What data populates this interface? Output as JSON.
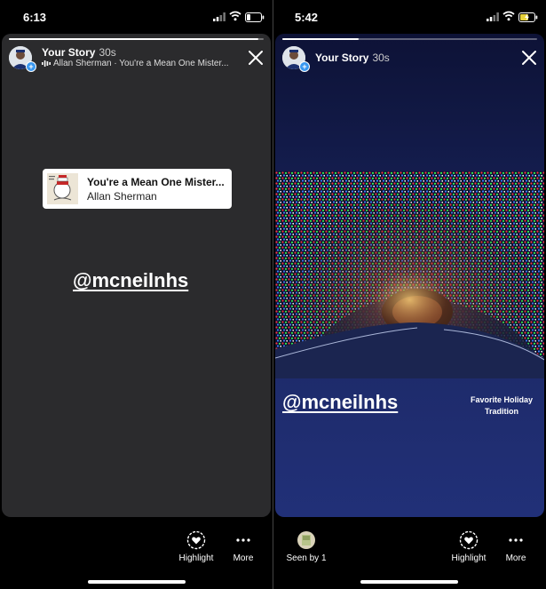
{
  "screens": [
    {
      "status_time": "6:13",
      "progress_fraction": 0.98,
      "story_title": "Your Story",
      "story_age": "30s",
      "music_line": "Allan Sherman · You're a Mean One Mister...",
      "song_title": "You're a Mean One Mister...",
      "song_artist": "Allan Sherman",
      "mention": "@mcneilnhs",
      "actions": {
        "highlight_label": "Highlight",
        "more_label": "More"
      }
    },
    {
      "status_time": "5:42",
      "progress_fraction": 0.3,
      "story_title": "Your Story",
      "story_age": "30s",
      "mention": "@mcneilnhs",
      "caption": "Favorite Holiday Tradition",
      "actions": {
        "seen_label": "Seen by 1",
        "highlight_label": "Highlight",
        "more_label": "More"
      }
    }
  ],
  "colors": {
    "story_dark": "#2b2b2d",
    "story_blue": "#1e2b6b",
    "accent": "#3897f0"
  },
  "icons": [
    "cellular-signal-icon",
    "wifi-icon",
    "battery-icon",
    "close-icon",
    "heart-highlight-icon",
    "more-dots-icon"
  ]
}
